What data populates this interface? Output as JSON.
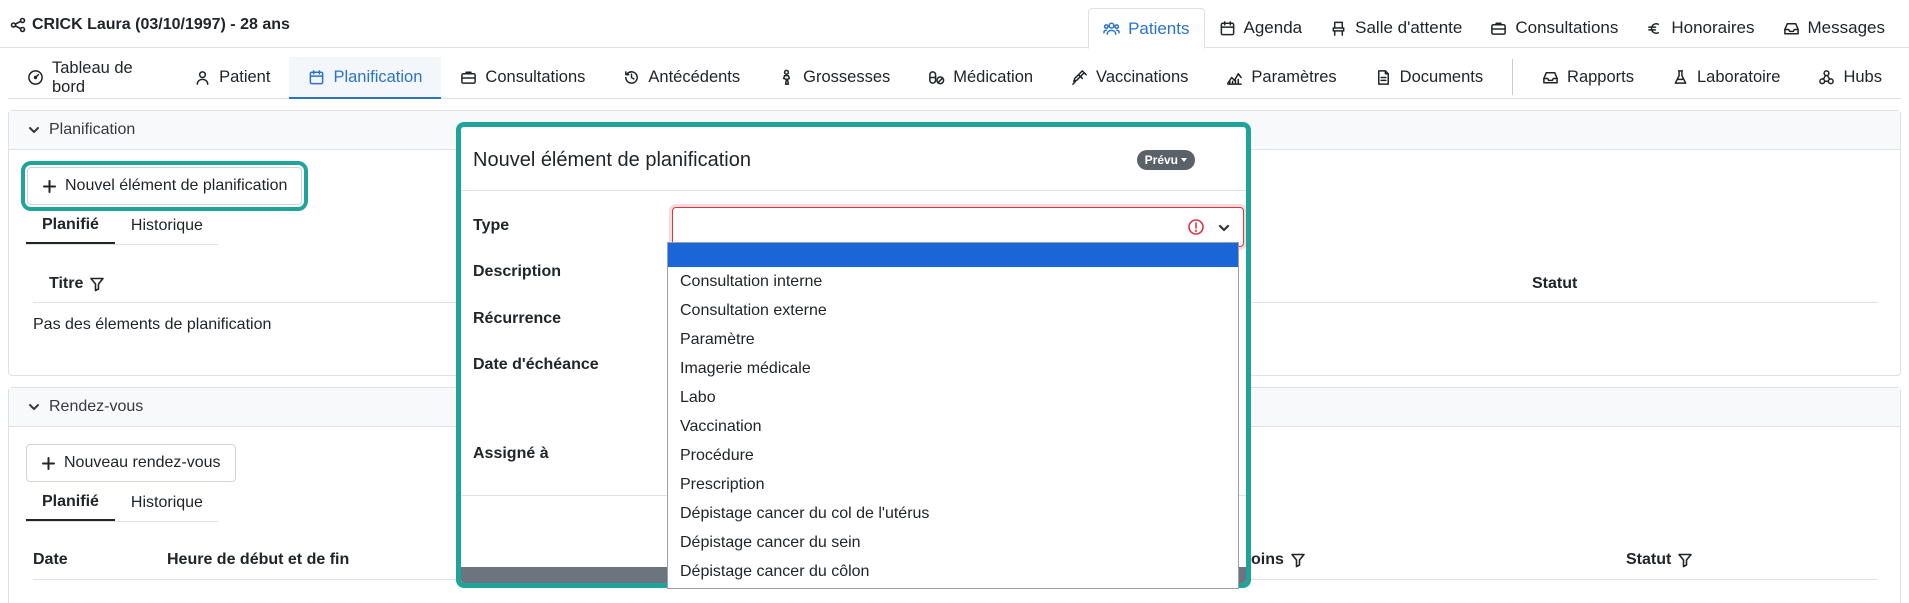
{
  "patient": {
    "label": "CRICK Laura (03/10/1997) - 28 ans"
  },
  "topnav": [
    {
      "label": "Patients",
      "icon": "users-icon",
      "active": true
    },
    {
      "label": "Agenda",
      "icon": "calendar-icon",
      "active": false
    },
    {
      "label": "Salle d'attente",
      "icon": "chair-icon",
      "active": false
    },
    {
      "label": "Consultations",
      "icon": "briefcase-icon",
      "active": false
    },
    {
      "label": "Honoraires",
      "icon": "euro-icon",
      "active": false
    },
    {
      "label": "Messages",
      "icon": "inbox-icon",
      "active": false
    }
  ],
  "subnav": [
    {
      "label": "Tableau de bord",
      "icon": "dashboard-icon"
    },
    {
      "label": "Patient",
      "icon": "person-icon"
    },
    {
      "label": "Planification",
      "icon": "calendar-icon",
      "active": true
    },
    {
      "label": "Consultations",
      "icon": "briefcase-icon"
    },
    {
      "label": "Antécédents",
      "icon": "history-icon"
    },
    {
      "label": "Grossesses",
      "icon": "pregnancy-icon"
    },
    {
      "label": "Médication",
      "icon": "pills-icon"
    },
    {
      "label": "Vaccinations",
      "icon": "syringe-icon"
    },
    {
      "label": "Paramètres",
      "icon": "chart-icon"
    },
    {
      "label": "Documents",
      "icon": "document-icon"
    },
    {
      "label": "Rapports",
      "icon": "inbox-icon"
    },
    {
      "label": "Laboratoire",
      "icon": "flask-icon"
    },
    {
      "label": "Hubs",
      "icon": "hubs-icon"
    }
  ],
  "planification": {
    "title": "Planification",
    "new_button": "Nouvel élément de planification",
    "tabs": [
      "Planifié",
      "Historique"
    ],
    "col_titre": "Titre",
    "col_statut": "Statut",
    "empty": "Pas des élements de planification"
  },
  "rdv": {
    "title": "Rendez-vous",
    "new_button": "Nouveau rendez-vous",
    "tabs": [
      "Planifié",
      "Historique"
    ],
    "col_date": "Date",
    "col_heure": "Heure de début et de fin",
    "col_soins": "oins",
    "col_statut": "Statut"
  },
  "modal": {
    "title": "Nouvel élément de planification",
    "badge": "Prévu",
    "labels": {
      "type": "Type",
      "description": "Description",
      "recurrence": "Récurrence",
      "date": "Date d'échéance",
      "assigne": "Assigné à"
    },
    "type_value": ""
  },
  "dropdown": {
    "options": [
      "Consultation interne",
      "Consultation externe",
      "Paramètre",
      "Imagerie médicale",
      "Labo",
      "Vaccination",
      "Procédure",
      "Prescription",
      "Dépistage cancer du col de l'utérus",
      "Dépistage cancer du sein",
      "Dépistage cancer du côlon"
    ]
  },
  "colors": {
    "accent": "#2b73c9",
    "highlight": "#1fa49c",
    "error": "#dc3545",
    "selected": "#1a66d6"
  }
}
